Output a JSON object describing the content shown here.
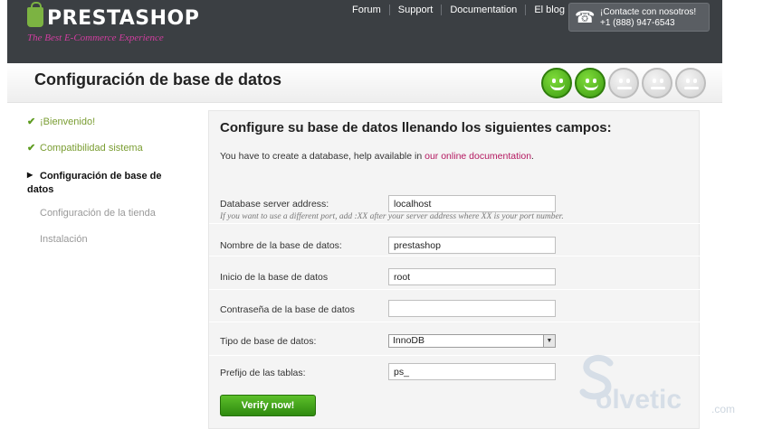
{
  "header": {
    "logo": "PRESTASHOP",
    "tagline": "The Best E-Commerce Experience",
    "nav": [
      "Forum",
      "Support",
      "Documentation",
      "El blog"
    ],
    "contact": {
      "label": "¡Contacte con nosotros!",
      "phone": "+1 (888) 947-6543"
    }
  },
  "title": "Configuración de base de datos",
  "progress": {
    "completed": 2,
    "total": 5
  },
  "sidebar": {
    "steps": [
      {
        "label": "¡Bienvenido!",
        "state": "done"
      },
      {
        "label": "Compatibilidad sistema",
        "state": "done"
      },
      {
        "label": "Configuración de base de datos",
        "state": "current"
      },
      {
        "label": "Configuración de la tienda",
        "state": "pending"
      },
      {
        "label": "Instalación",
        "state": "pending"
      }
    ]
  },
  "form": {
    "heading": "Configure su base de datos llenando los siguientes campos:",
    "intro": "You have to create a database, help available in ",
    "intro_link": "our online documentation",
    "intro_end": ".",
    "server": {
      "label": "Database server address:",
      "value": "localhost",
      "hint": "If you want to use a different port, add :XX after your server address where XX is your port number."
    },
    "dbname": {
      "label": "Nombre de la base de datos:",
      "value": "prestashop"
    },
    "login": {
      "label": "Inicio de la base de datos",
      "value": "root"
    },
    "password": {
      "label": "Contraseña de la base de datos",
      "value": ""
    },
    "engine": {
      "label": "Tipo de base de datos:",
      "value": "InnoDB"
    },
    "prefix": {
      "label": "Prefijo de las tablas:",
      "value": "ps_"
    },
    "verify_label": "Verify now!"
  },
  "watermark": {
    "text": "olvetic",
    "suffix": ".com"
  },
  "colors": {
    "header_bg": "#3b3f43",
    "accent_green": "#5d9b1f",
    "link": "#b3175f",
    "tagline": "#d13ea0"
  }
}
